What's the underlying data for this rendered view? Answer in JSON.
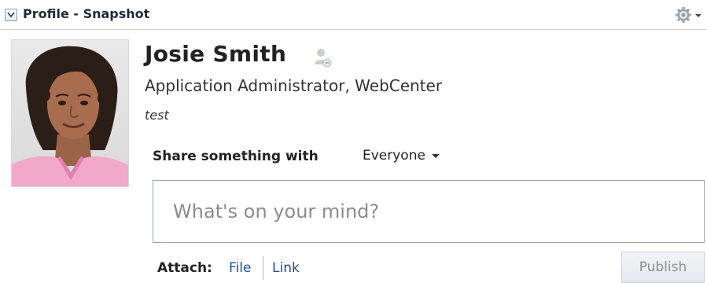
{
  "header": {
    "title": "Profile - Snapshot",
    "collapse_icon": "chevron-down-icon",
    "menu_icon": "gear-icon"
  },
  "profile": {
    "name": "Josie Smith",
    "presence_icon": "presence-offline-icon",
    "title": "Application Administrator, WebCenter",
    "status": "test",
    "photo_icon": "user-photo"
  },
  "share": {
    "label": "Share something with",
    "audience": "Everyone",
    "placeholder": "What's on your mind?",
    "value": ""
  },
  "attach": {
    "label": "Attach:",
    "file": "File",
    "link": "Link"
  },
  "actions": {
    "publish": "Publish"
  },
  "colors": {
    "link": "#1d4e96",
    "border": "#c9d3dd",
    "disabled_text": "#8a8f96"
  }
}
